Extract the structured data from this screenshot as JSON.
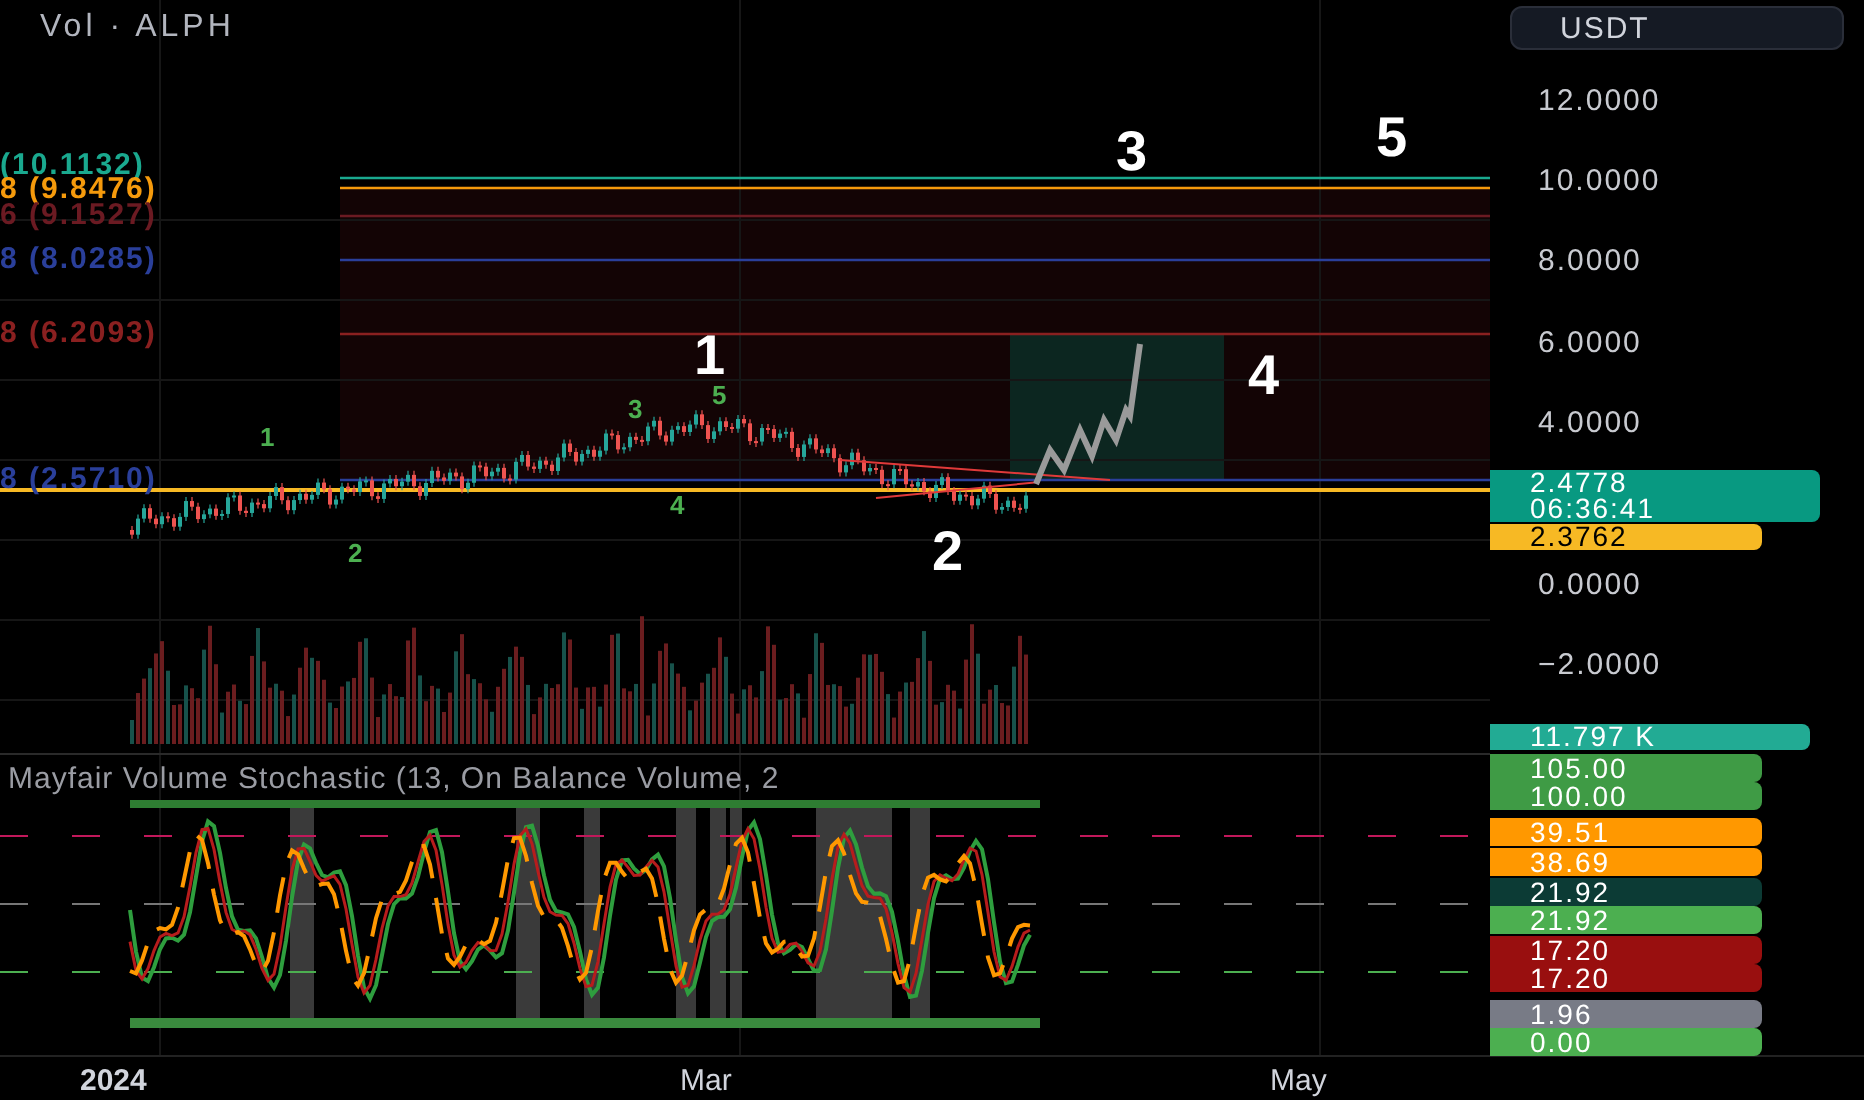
{
  "header": {
    "title": "Vol · ALPH"
  },
  "currency_button": {
    "label": "USDT"
  },
  "price_axis": [
    "12.0000",
    "10.0000",
    "8.0000",
    "6.0000",
    "4.0000",
    "0.0000",
    "−2.0000"
  ],
  "price_tags": [
    {
      "text": "2.4778",
      "subtext": "06:36:41",
      "color": "#089981"
    },
    {
      "text": "2.3762",
      "color": "#f7b924"
    },
    {
      "text": "11.797 K",
      "color": "#22ab94"
    }
  ],
  "fib_levels": [
    {
      "label": "(10.1132)",
      "color": "#1aa98f"
    },
    {
      "label": "8 (9.8476)",
      "color": "#f59a0c"
    },
    {
      "label": "6 (9.1527)",
      "color": "#6b1a22"
    },
    {
      "label": "8 (8.0285)",
      "color": "#2a3f9a"
    },
    {
      "label": "8 (6.2093)",
      "color": "#8a2020"
    },
    {
      "label": "8 (2.5710)",
      "color": "#2a3f9a"
    }
  ],
  "major_wave_labels": [
    "1",
    "2",
    "3",
    "4",
    "5"
  ],
  "minor_wave_labels": [
    "1",
    "2",
    "3",
    "4",
    "5"
  ],
  "indicator": {
    "title": "Mayfair Volume Stochastic (13, On Balance Volume, 2",
    "tags": [
      {
        "text": "105.00",
        "color": "#3f9b45"
      },
      {
        "text": "100.00",
        "color": "#3f9b45"
      },
      {
        "text": "39.51",
        "color": "#ff9800"
      },
      {
        "text": "38.69",
        "color": "#ff9800"
      },
      {
        "text": "21.92",
        "color": "#0c3b35"
      },
      {
        "text": "21.92",
        "color": "#4caf50"
      },
      {
        "text": "17.20",
        "color": "#990f0f"
      },
      {
        "text": "17.20",
        "color": "#990f0f"
      },
      {
        "text": "1.96",
        "color": "#787b86"
      },
      {
        "text": "0.00",
        "color": "#4caf50"
      }
    ]
  },
  "time_axis": [
    "2024",
    "Mar",
    "May"
  ]
}
